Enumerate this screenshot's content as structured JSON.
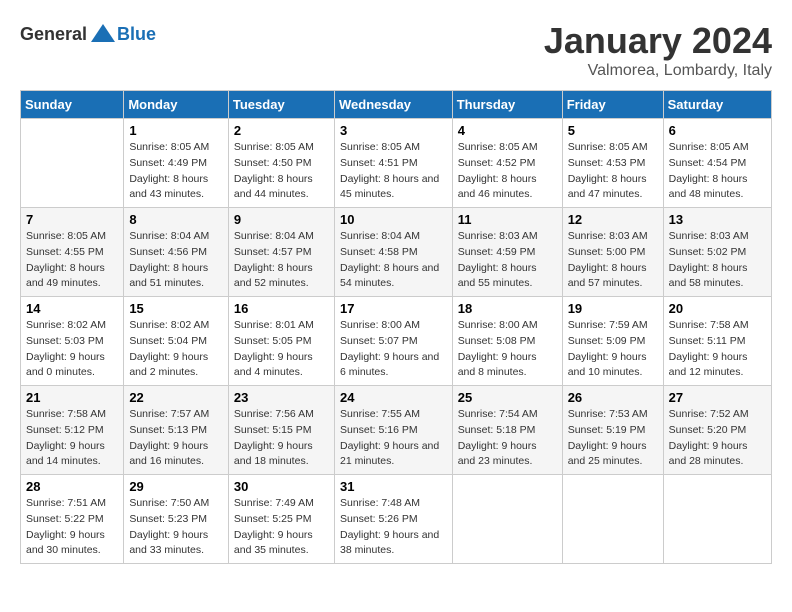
{
  "logo": {
    "general": "General",
    "blue": "Blue"
  },
  "title": "January 2024",
  "subtitle": "Valmorea, Lombardy, Italy",
  "days_of_week": [
    "Sunday",
    "Monday",
    "Tuesday",
    "Wednesday",
    "Thursday",
    "Friday",
    "Saturday"
  ],
  "weeks": [
    [
      {
        "day": "",
        "sunrise": "",
        "sunset": "",
        "daylight": ""
      },
      {
        "day": "1",
        "sunrise": "Sunrise: 8:05 AM",
        "sunset": "Sunset: 4:49 PM",
        "daylight": "Daylight: 8 hours and 43 minutes."
      },
      {
        "day": "2",
        "sunrise": "Sunrise: 8:05 AM",
        "sunset": "Sunset: 4:50 PM",
        "daylight": "Daylight: 8 hours and 44 minutes."
      },
      {
        "day": "3",
        "sunrise": "Sunrise: 8:05 AM",
        "sunset": "Sunset: 4:51 PM",
        "daylight": "Daylight: 8 hours and 45 minutes."
      },
      {
        "day": "4",
        "sunrise": "Sunrise: 8:05 AM",
        "sunset": "Sunset: 4:52 PM",
        "daylight": "Daylight: 8 hours and 46 minutes."
      },
      {
        "day": "5",
        "sunrise": "Sunrise: 8:05 AM",
        "sunset": "Sunset: 4:53 PM",
        "daylight": "Daylight: 8 hours and 47 minutes."
      },
      {
        "day": "6",
        "sunrise": "Sunrise: 8:05 AM",
        "sunset": "Sunset: 4:54 PM",
        "daylight": "Daylight: 8 hours and 48 minutes."
      }
    ],
    [
      {
        "day": "7",
        "sunrise": "Sunrise: 8:05 AM",
        "sunset": "Sunset: 4:55 PM",
        "daylight": "Daylight: 8 hours and 49 minutes."
      },
      {
        "day": "8",
        "sunrise": "Sunrise: 8:04 AM",
        "sunset": "Sunset: 4:56 PM",
        "daylight": "Daylight: 8 hours and 51 minutes."
      },
      {
        "day": "9",
        "sunrise": "Sunrise: 8:04 AM",
        "sunset": "Sunset: 4:57 PM",
        "daylight": "Daylight: 8 hours and 52 minutes."
      },
      {
        "day": "10",
        "sunrise": "Sunrise: 8:04 AM",
        "sunset": "Sunset: 4:58 PM",
        "daylight": "Daylight: 8 hours and 54 minutes."
      },
      {
        "day": "11",
        "sunrise": "Sunrise: 8:03 AM",
        "sunset": "Sunset: 4:59 PM",
        "daylight": "Daylight: 8 hours and 55 minutes."
      },
      {
        "day": "12",
        "sunrise": "Sunrise: 8:03 AM",
        "sunset": "Sunset: 5:00 PM",
        "daylight": "Daylight: 8 hours and 57 minutes."
      },
      {
        "day": "13",
        "sunrise": "Sunrise: 8:03 AM",
        "sunset": "Sunset: 5:02 PM",
        "daylight": "Daylight: 8 hours and 58 minutes."
      }
    ],
    [
      {
        "day": "14",
        "sunrise": "Sunrise: 8:02 AM",
        "sunset": "Sunset: 5:03 PM",
        "daylight": "Daylight: 9 hours and 0 minutes."
      },
      {
        "day": "15",
        "sunrise": "Sunrise: 8:02 AM",
        "sunset": "Sunset: 5:04 PM",
        "daylight": "Daylight: 9 hours and 2 minutes."
      },
      {
        "day": "16",
        "sunrise": "Sunrise: 8:01 AM",
        "sunset": "Sunset: 5:05 PM",
        "daylight": "Daylight: 9 hours and 4 minutes."
      },
      {
        "day": "17",
        "sunrise": "Sunrise: 8:00 AM",
        "sunset": "Sunset: 5:07 PM",
        "daylight": "Daylight: 9 hours and 6 minutes."
      },
      {
        "day": "18",
        "sunrise": "Sunrise: 8:00 AM",
        "sunset": "Sunset: 5:08 PM",
        "daylight": "Daylight: 9 hours and 8 minutes."
      },
      {
        "day": "19",
        "sunrise": "Sunrise: 7:59 AM",
        "sunset": "Sunset: 5:09 PM",
        "daylight": "Daylight: 9 hours and 10 minutes."
      },
      {
        "day": "20",
        "sunrise": "Sunrise: 7:58 AM",
        "sunset": "Sunset: 5:11 PM",
        "daylight": "Daylight: 9 hours and 12 minutes."
      }
    ],
    [
      {
        "day": "21",
        "sunrise": "Sunrise: 7:58 AM",
        "sunset": "Sunset: 5:12 PM",
        "daylight": "Daylight: 9 hours and 14 minutes."
      },
      {
        "day": "22",
        "sunrise": "Sunrise: 7:57 AM",
        "sunset": "Sunset: 5:13 PM",
        "daylight": "Daylight: 9 hours and 16 minutes."
      },
      {
        "day": "23",
        "sunrise": "Sunrise: 7:56 AM",
        "sunset": "Sunset: 5:15 PM",
        "daylight": "Daylight: 9 hours and 18 minutes."
      },
      {
        "day": "24",
        "sunrise": "Sunrise: 7:55 AM",
        "sunset": "Sunset: 5:16 PM",
        "daylight": "Daylight: 9 hours and 21 minutes."
      },
      {
        "day": "25",
        "sunrise": "Sunrise: 7:54 AM",
        "sunset": "Sunset: 5:18 PM",
        "daylight": "Daylight: 9 hours and 23 minutes."
      },
      {
        "day": "26",
        "sunrise": "Sunrise: 7:53 AM",
        "sunset": "Sunset: 5:19 PM",
        "daylight": "Daylight: 9 hours and 25 minutes."
      },
      {
        "day": "27",
        "sunrise": "Sunrise: 7:52 AM",
        "sunset": "Sunset: 5:20 PM",
        "daylight": "Daylight: 9 hours and 28 minutes."
      }
    ],
    [
      {
        "day": "28",
        "sunrise": "Sunrise: 7:51 AM",
        "sunset": "Sunset: 5:22 PM",
        "daylight": "Daylight: 9 hours and 30 minutes."
      },
      {
        "day": "29",
        "sunrise": "Sunrise: 7:50 AM",
        "sunset": "Sunset: 5:23 PM",
        "daylight": "Daylight: 9 hours and 33 minutes."
      },
      {
        "day": "30",
        "sunrise": "Sunrise: 7:49 AM",
        "sunset": "Sunset: 5:25 PM",
        "daylight": "Daylight: 9 hours and 35 minutes."
      },
      {
        "day": "31",
        "sunrise": "Sunrise: 7:48 AM",
        "sunset": "Sunset: 5:26 PM",
        "daylight": "Daylight: 9 hours and 38 minutes."
      },
      {
        "day": "",
        "sunrise": "",
        "sunset": "",
        "daylight": ""
      },
      {
        "day": "",
        "sunrise": "",
        "sunset": "",
        "daylight": ""
      },
      {
        "day": "",
        "sunrise": "",
        "sunset": "",
        "daylight": ""
      }
    ]
  ]
}
